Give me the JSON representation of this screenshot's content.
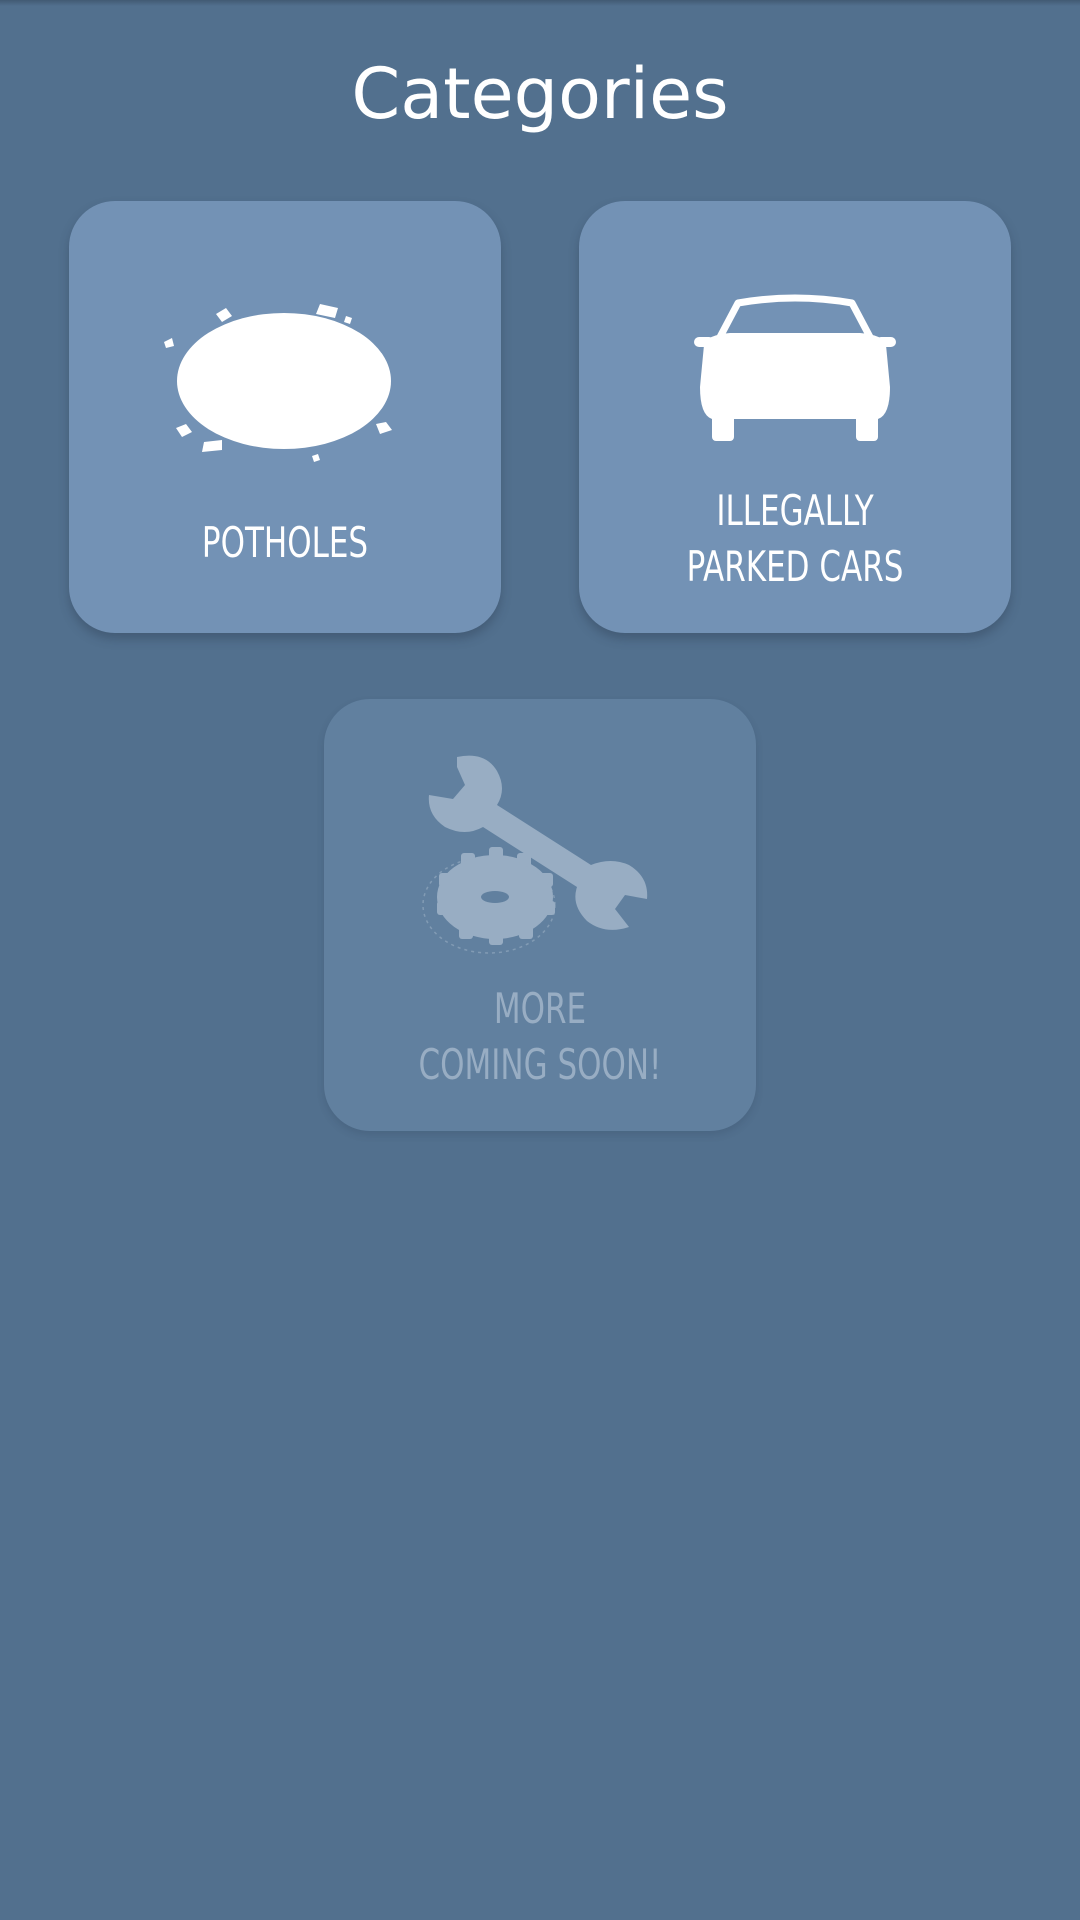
{
  "header": {
    "title": "Categories"
  },
  "categories": [
    {
      "id": "potholes",
      "lines": [
        "POTHOLES"
      ],
      "icon": "pothole-icon",
      "enabled": true
    },
    {
      "id": "illegally-parked-cars",
      "lines": [
        "ILLEGALLY",
        "PARKED CARS"
      ],
      "icon": "car-icon",
      "enabled": true
    },
    {
      "id": "more",
      "lines": [
        "MORE",
        "COMING SOON!"
      ],
      "icon": "wrench-gear-icon",
      "enabled": false
    }
  ],
  "colors": {
    "background": "#52708e",
    "card": "#7392b5",
    "card_disabled": "#61809f",
    "text": "#ffffff",
    "text_disabled": "#98adc3"
  }
}
